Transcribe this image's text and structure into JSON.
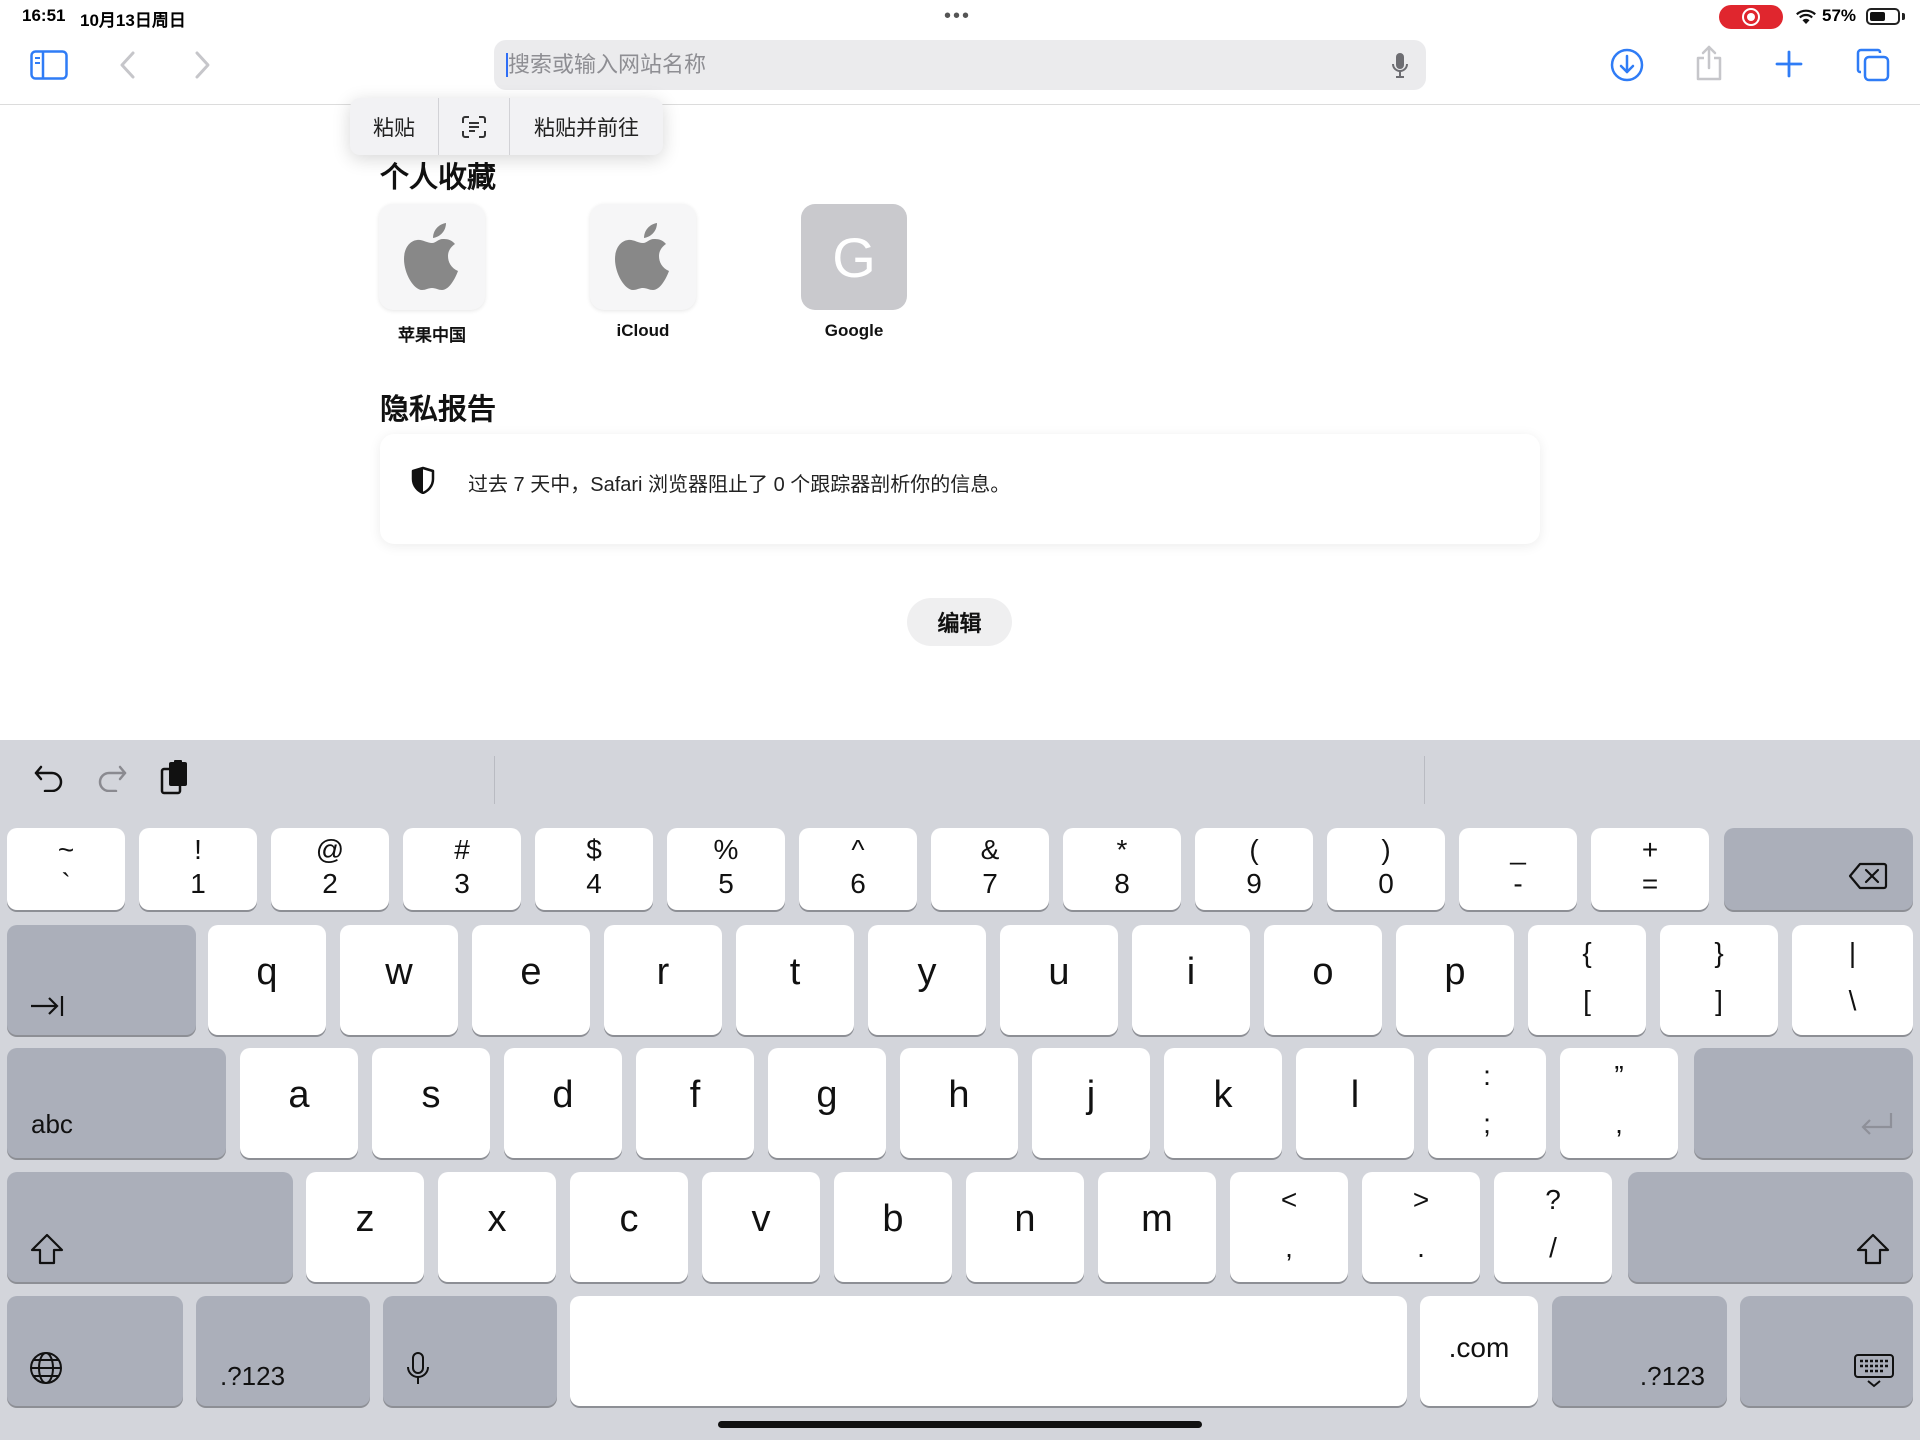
{
  "status_bar": {
    "time": "16:51",
    "date": "10月13日周日",
    "battery": "57%"
  },
  "toolbar": {
    "url_placeholder": "搜索或输入网站名称",
    "icons": [
      "sidebar-icon",
      "back-icon",
      "forward-icon",
      "microphone-icon",
      "download-icon",
      "share-icon",
      "plus-icon",
      "tabs-icon"
    ]
  },
  "paste_menu": {
    "paste": "粘贴",
    "paste_and_go": "粘贴并前往"
  },
  "favorites": {
    "title": "个人收藏",
    "items": [
      {
        "label": "苹果中国",
        "icon": "apple-logo-icon"
      },
      {
        "label": "iCloud",
        "icon": "apple-logo-icon"
      },
      {
        "label": "Google",
        "letter": "G"
      }
    ]
  },
  "privacy": {
    "title": "隐私报告",
    "text": "过去 7 天中，Safari 浏览器阻止了 0 个跟踪器剖析你的信息。"
  },
  "edit_label": "编辑",
  "keyboard": {
    "row1": [
      [
        "~",
        "`"
      ],
      [
        "!",
        "1"
      ],
      [
        "@",
        "2"
      ],
      [
        "#",
        "3"
      ],
      [
        "$",
        "4"
      ],
      [
        "%",
        "5"
      ],
      [
        "^",
        "6"
      ],
      [
        "&",
        "7"
      ],
      [
        "*",
        "8"
      ],
      [
        "(",
        "9"
      ],
      [
        ")",
        "0"
      ],
      [
        "_",
        "-"
      ],
      [
        "+",
        "="
      ]
    ],
    "row2": [
      "q",
      "w",
      "e",
      "r",
      "t",
      "y",
      "u",
      "i",
      "o",
      "p"
    ],
    "row2_sym": [
      [
        "{",
        "["
      ],
      [
        "}",
        "]"
      ],
      [
        "|",
        "\\"
      ]
    ],
    "row3": [
      "a",
      "s",
      "d",
      "f",
      "g",
      "h",
      "j",
      "k",
      "l"
    ],
    "row3_sym": [
      [
        ":",
        ";"
      ],
      [
        "”",
        ","
      ]
    ],
    "row4": [
      "z",
      "x",
      "c",
      "v",
      "b",
      "n",
      "m"
    ],
    "row4_sym": [
      [
        "<",
        ","
      ],
      [
        ">",
        "."
      ],
      [
        "?",
        "/"
      ]
    ],
    "abc_label": "abc",
    "numbers_label": ".?123",
    "dotcom_label": ".com"
  }
}
